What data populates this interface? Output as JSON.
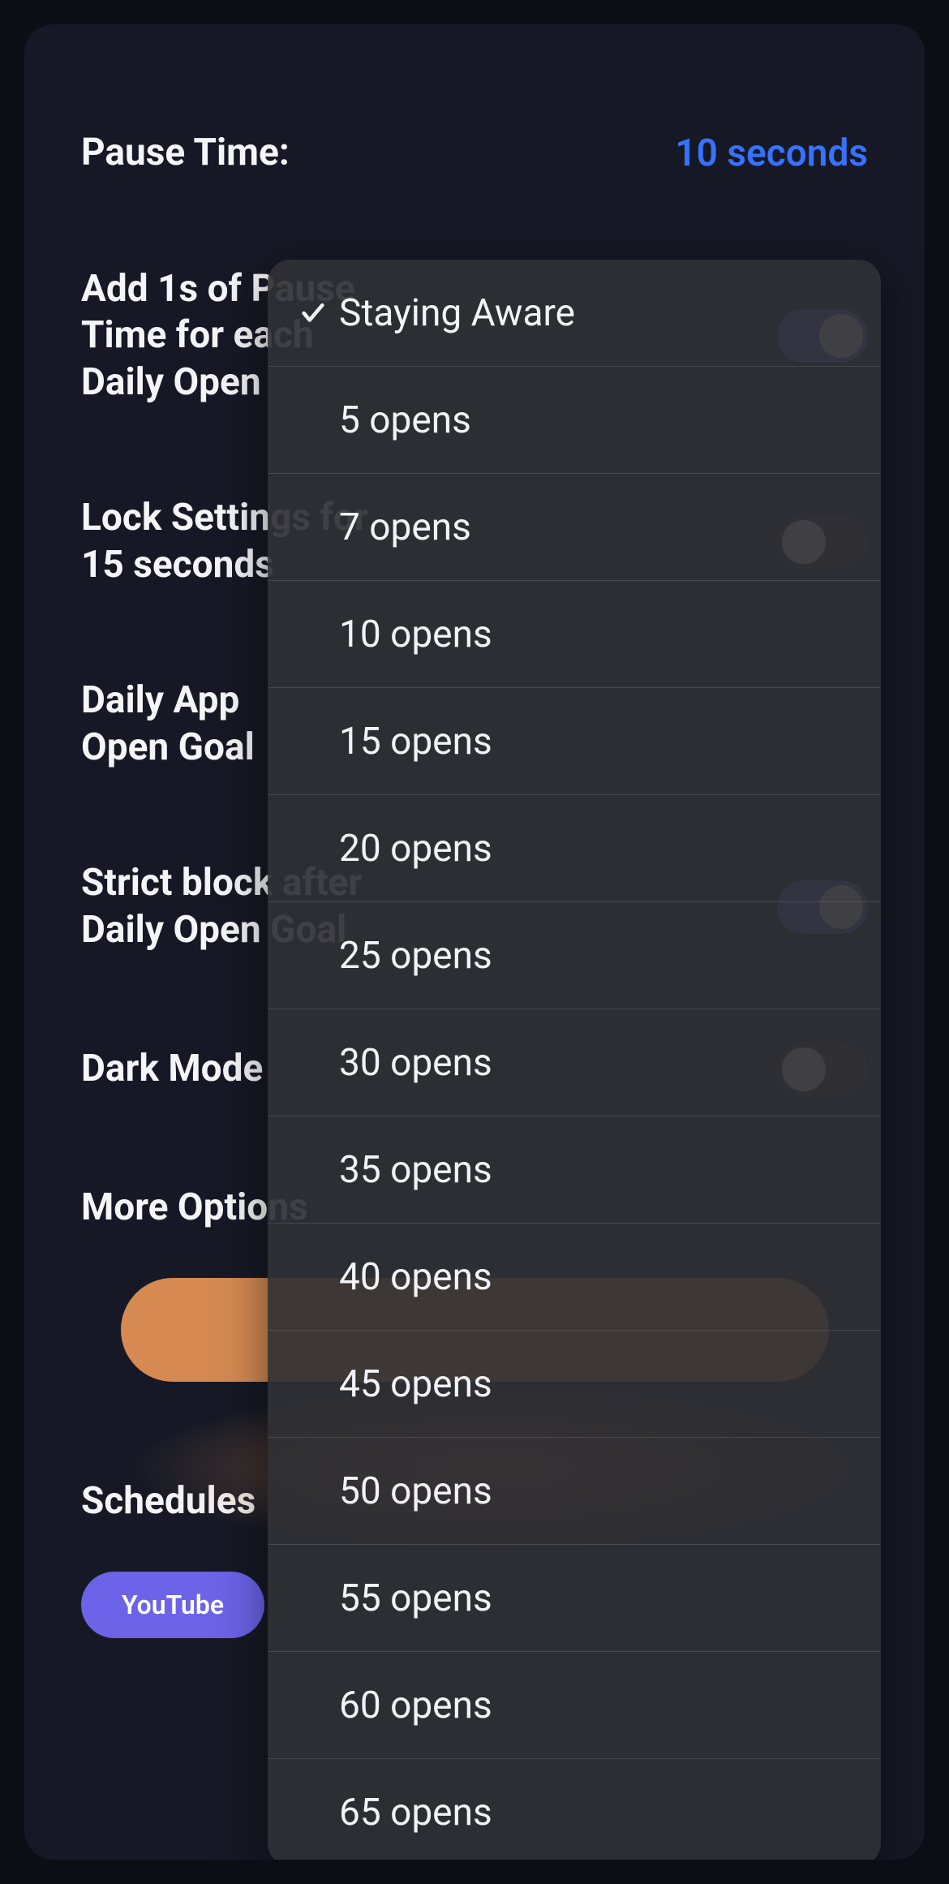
{
  "settings": {
    "pause_time_label": "Pause Time:",
    "pause_time_value": "10 seconds",
    "add1s_label": "Add 1s of Pause\nTime for each\nDaily Open",
    "lock_label": "Lock Settings for\n15 seconds",
    "daily_goal_label": "Daily App\nOpen Goal",
    "strict_label": "Strict block after\nDaily Open Goal",
    "dark_mode_label": "Dark Mode",
    "more_options_label": "More Options",
    "schedules_label": "Schedules",
    "chip_label": "YouTube"
  },
  "dropdown": {
    "items": [
      {
        "label": "Staying Aware",
        "checked": true
      },
      {
        "label": "5 opens",
        "checked": false
      },
      {
        "label": "7 opens",
        "checked": false
      },
      {
        "label": "10 opens",
        "checked": false
      },
      {
        "label": "15 opens",
        "checked": false
      },
      {
        "label": "20 opens",
        "checked": false
      },
      {
        "label": "25 opens",
        "checked": false
      },
      {
        "label": "30 opens",
        "checked": false
      },
      {
        "label": "35 opens",
        "checked": false
      },
      {
        "label": "40 opens",
        "checked": false
      },
      {
        "label": "45 opens",
        "checked": false
      },
      {
        "label": "50 opens",
        "checked": false
      },
      {
        "label": "55 opens",
        "checked": false
      },
      {
        "label": "60 opens",
        "checked": false
      },
      {
        "label": "65 opens",
        "checked": false
      }
    ]
  }
}
